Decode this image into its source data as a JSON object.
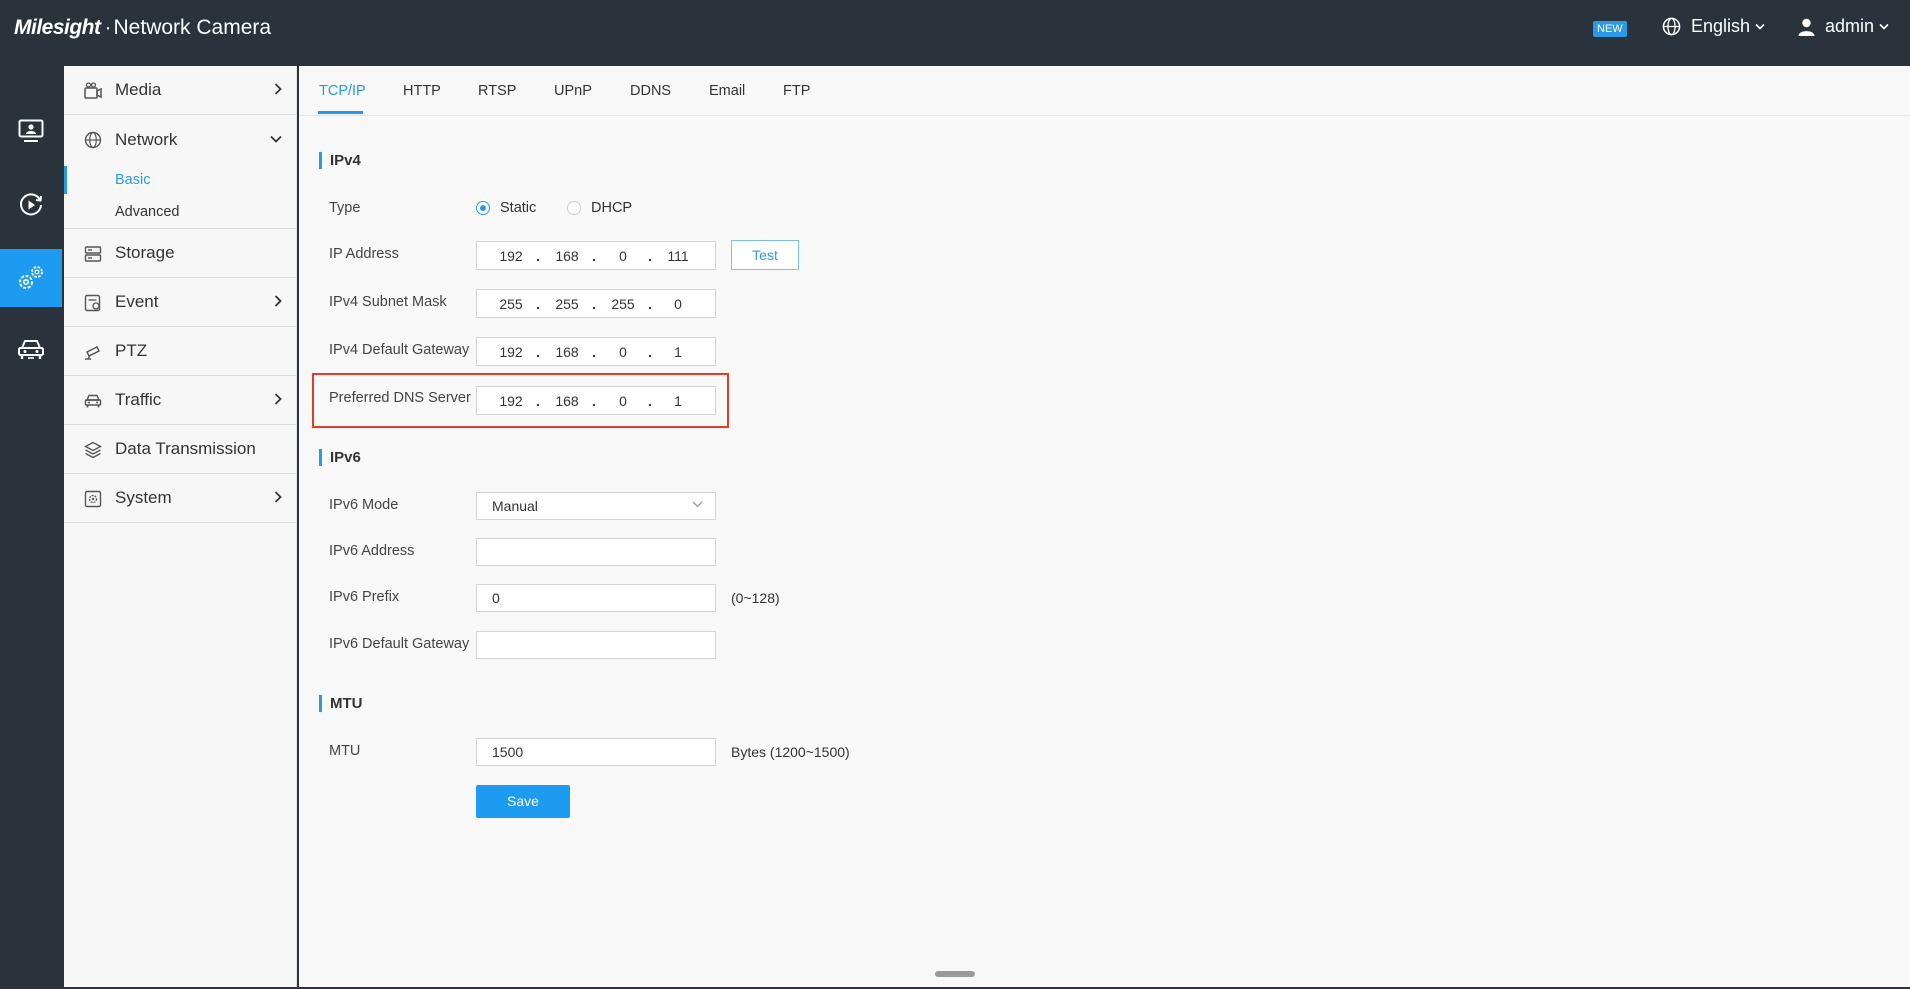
{
  "header": {
    "brand_logo": "Milesight",
    "brand_sep": "·",
    "brand_title": "Network Camera",
    "new_badge": "NEW",
    "language": "English",
    "user": "admin"
  },
  "rail": {
    "items": [
      {
        "icon": "monitor-icon"
      },
      {
        "icon": "playback-icon"
      },
      {
        "icon": "settings-icon",
        "active": true
      },
      {
        "icon": "vehicle-icon"
      }
    ]
  },
  "sidebar": {
    "items": [
      {
        "label": "Media",
        "icon": "media-icon"
      },
      {
        "label": "Network",
        "icon": "globe-icon",
        "sub": [
          "Basic",
          "Advanced"
        ],
        "active_sub": "Basic"
      },
      {
        "label": "Storage",
        "icon": "storage-icon"
      },
      {
        "label": "Event",
        "icon": "event-icon"
      },
      {
        "label": "PTZ",
        "icon": "ptz-icon"
      },
      {
        "label": "Traffic",
        "icon": "car-icon"
      },
      {
        "label": "Data Transmission",
        "icon": "layers-icon"
      },
      {
        "label": "System",
        "icon": "system-icon"
      }
    ]
  },
  "tabs": [
    "TCP/IP",
    "HTTP",
    "RTSP",
    "UPnP",
    "DDNS",
    "Email",
    "FTP"
  ],
  "active_tab": "TCP/IP",
  "ipv4": {
    "section_title": "IPv4",
    "type_label": "Type",
    "type_options": [
      "Static",
      "DHCP"
    ],
    "type_selected": "Static",
    "ip_address_label": "IP Address",
    "ip_address": [
      "192",
      "168",
      "0",
      "111"
    ],
    "test_label": "Test",
    "subnet_label": "IPv4 Subnet Mask",
    "subnet": [
      "255",
      "255",
      "255",
      "0"
    ],
    "gateway_label": "IPv4 Default Gateway",
    "gateway": [
      "192",
      "168",
      "0",
      "1"
    ],
    "dns_label": "Preferred DNS Server",
    "dns": [
      "192",
      "168",
      "0",
      "1"
    ]
  },
  "ipv6": {
    "section_title": "IPv6",
    "mode_label": "IPv6 Mode",
    "mode_value": "Manual",
    "address_label": "IPv6 Address",
    "address_value": "",
    "prefix_label": "IPv6 Prefix",
    "prefix_value": "0",
    "prefix_hint": "(0~128)",
    "gateway_label": "IPv6 Default Gateway",
    "gateway_value": ""
  },
  "mtu": {
    "section_title": "MTU",
    "label": "MTU",
    "value": "1500",
    "hint": "Bytes (1200~1500)"
  },
  "save_label": "Save",
  "dot": ".",
  "colors": {
    "accent": "#1c9bf0",
    "topbar": "#2a323c",
    "highlight": "#e53b2a"
  }
}
